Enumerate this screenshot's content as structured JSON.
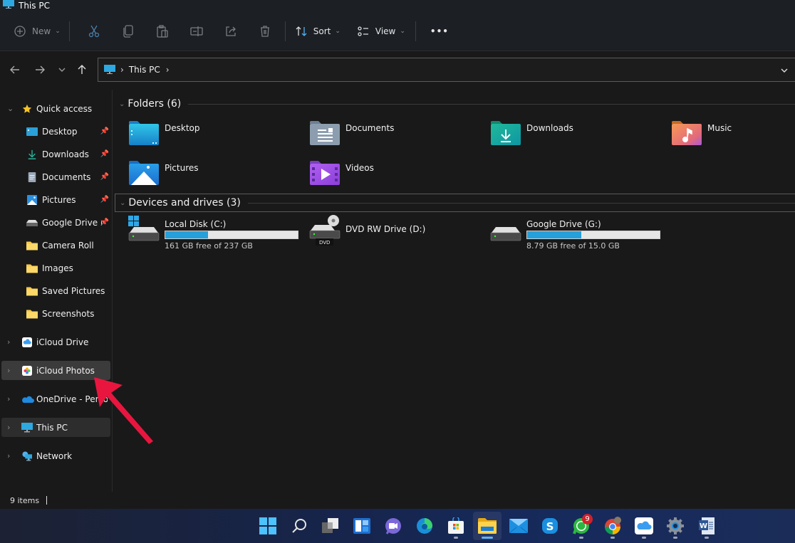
{
  "window": {
    "title": "This PC"
  },
  "toolbar": {
    "new_label": "New",
    "cut_tooltip": "Cut",
    "copy_tooltip": "Copy",
    "paste_tooltip": "Paste",
    "rename_tooltip": "Rename",
    "share_tooltip": "Share",
    "delete_tooltip": "Delete",
    "sort_label": "Sort",
    "view_label": "View",
    "more_label": "•••"
  },
  "address": {
    "segments": [
      "This PC"
    ],
    "separator": "›"
  },
  "sidebar": {
    "quick_access": {
      "label": "Quick access",
      "items": [
        {
          "label": "Desktop",
          "icon": "desktop-folder-icon",
          "pinned": true
        },
        {
          "label": "Downloads",
          "icon": "download-icon",
          "pinned": true
        },
        {
          "label": "Documents",
          "icon": "document-icon",
          "pinned": true
        },
        {
          "label": "Pictures",
          "icon": "pictures-icon",
          "pinned": true
        },
        {
          "label": "Google Drive (G:)",
          "icon": "drive-icon",
          "pinned": true
        },
        {
          "label": "Camera Roll",
          "icon": "folder-icon",
          "pinned": false
        },
        {
          "label": "Images",
          "icon": "folder-icon",
          "pinned": false
        },
        {
          "label": "Saved Pictures",
          "icon": "folder-icon",
          "pinned": false
        },
        {
          "label": "Screenshots",
          "icon": "folder-icon",
          "pinned": false
        }
      ]
    },
    "roots": [
      {
        "label": "iCloud Drive",
        "icon": "icloud-drive-icon"
      },
      {
        "label": "iCloud Photos",
        "icon": "icloud-photos-icon",
        "state": "hovered"
      },
      {
        "label": "OneDrive - Personal",
        "icon": "onedrive-icon"
      },
      {
        "label": "This PC",
        "icon": "this-pc-icon",
        "state": "selected"
      },
      {
        "label": "Network",
        "icon": "network-icon"
      }
    ]
  },
  "content": {
    "folders_header": "Folders (6)",
    "folders": [
      {
        "name": "Desktop",
        "icon": "desktop-folder-icon"
      },
      {
        "name": "Documents",
        "icon": "documents-folder-icon"
      },
      {
        "name": "Downloads",
        "icon": "downloads-folder-icon"
      },
      {
        "name": "Music",
        "icon": "music-folder-icon"
      },
      {
        "name": "Pictures",
        "icon": "pictures-folder-icon"
      },
      {
        "name": "Videos",
        "icon": "videos-folder-icon"
      }
    ],
    "drives_header": "Devices and drives (3)",
    "drives": [
      {
        "name": "Local Disk (C:)",
        "free_text": "161 GB free of 237 GB",
        "used_fraction": 0.32,
        "icon": "windows-drive-icon"
      },
      {
        "name": "DVD RW Drive (D:)",
        "free_text": "",
        "icon": "dvd-drive-icon",
        "dvd_label": "DVD"
      },
      {
        "name": "Google Drive (G:)",
        "free_text": "8.79 GB free of 15.0 GB",
        "used_fraction": 0.41,
        "icon": "drive-icon"
      }
    ]
  },
  "status": {
    "items_count": "9 items"
  },
  "taskbar": {
    "apps": [
      {
        "name": "start",
        "icon": "windows-start-icon"
      },
      {
        "name": "search",
        "icon": "search-icon"
      },
      {
        "name": "task-view",
        "icon": "task-view-icon"
      },
      {
        "name": "widgets",
        "icon": "widgets-icon"
      },
      {
        "name": "teams-chat",
        "icon": "teams-chat-icon"
      },
      {
        "name": "edge",
        "icon": "edge-icon"
      },
      {
        "name": "store",
        "icon": "store-icon",
        "running": true
      },
      {
        "name": "file-explorer",
        "icon": "file-explorer-icon",
        "active": true
      },
      {
        "name": "mail",
        "icon": "mail-icon"
      },
      {
        "name": "skype",
        "icon": "skype-icon"
      },
      {
        "name": "whatsapp",
        "icon": "whatsapp-icon",
        "badge": "9",
        "running": true
      },
      {
        "name": "chrome",
        "icon": "chrome-icon",
        "running": true
      },
      {
        "name": "icloud",
        "icon": "icloud-icon",
        "running": true
      },
      {
        "name": "settings",
        "icon": "settings-icon",
        "running": true
      },
      {
        "name": "word",
        "icon": "word-icon",
        "running": true
      }
    ]
  },
  "colors": {
    "accent": "#26a0da",
    "annotation_arrow": "#e8163f",
    "badge": "#d3202a"
  }
}
